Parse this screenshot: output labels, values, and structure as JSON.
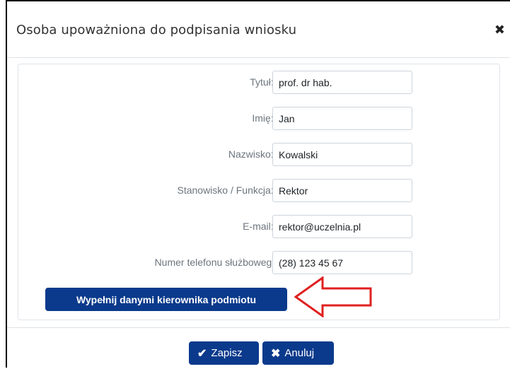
{
  "dialog": {
    "title": "Osoba upoważniona do podpisania wniosku",
    "close_glyph": "✖"
  },
  "form": {
    "fields": [
      {
        "label": "Tytuł: *",
        "value": "prof. dr hab."
      },
      {
        "label": "Imię: *",
        "value": "Jan"
      },
      {
        "label": "Nazwisko: *",
        "value": "Kowalski"
      },
      {
        "label": "Stanowisko / Funkcja: *",
        "value": "Rektor"
      },
      {
        "label": "E-mail: *",
        "value": "rektor@uczelnia.pl"
      },
      {
        "label": "Numer telefonu służbowego:",
        "value": "(28) 123 45 67"
      }
    ],
    "fill_button_label": "Wypełnij danymi kierownika podmiotu"
  },
  "footer": {
    "save_label": "Zapisz",
    "save_icon": "check-icon",
    "cancel_label": "Anuluj",
    "cancel_icon": "x-icon"
  },
  "colors": {
    "primary": "#0b3a8c",
    "arrow": "#e02020"
  }
}
